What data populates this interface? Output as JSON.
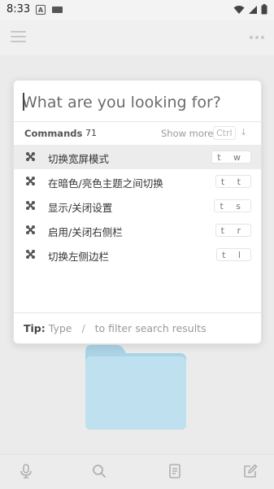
{
  "status_bar": {
    "time": "8:33",
    "notification_icon": "a-letter-icon",
    "keyboard_icon": "keyboard-icon",
    "wifi_icon": "wifi-icon",
    "signal_icon": "signal-icon",
    "battery_icon": "battery-icon"
  },
  "header": {
    "menu_icon": "hamburger-icon",
    "more_icon": "more-dots-icon"
  },
  "palette": {
    "search_placeholder": "What are you looking for?",
    "commands_title": "Commands",
    "commands_count": "71",
    "show_more": "Show more",
    "ctrl_key": "Ctrl",
    "arrow_key": "↓",
    "items": [
      {
        "label": "切换宽屏模式",
        "keys": "t w",
        "selected": true
      },
      {
        "label": "在暗色/亮色主题之间切换",
        "keys": "t t",
        "selected": false
      },
      {
        "label": "显示/关闭设置",
        "keys": "t s",
        "selected": false
      },
      {
        "label": "启用/关闭右侧栏",
        "keys": "t r",
        "selected": false
      },
      {
        "label": "切换左侧边栏",
        "keys": "t l",
        "selected": false
      }
    ],
    "tip": {
      "label": "Tip:",
      "before": "Type",
      "slash": "/",
      "after": "to filter search results"
    }
  },
  "bottom_bar": {
    "icons": [
      "microphone-icon",
      "search-icon",
      "document-icon",
      "edit-icon"
    ]
  },
  "colors": {
    "background": "#ebebeb",
    "palette_bg": "#ffffff",
    "selected_row": "#ececec",
    "folder": "#b9dcea"
  }
}
